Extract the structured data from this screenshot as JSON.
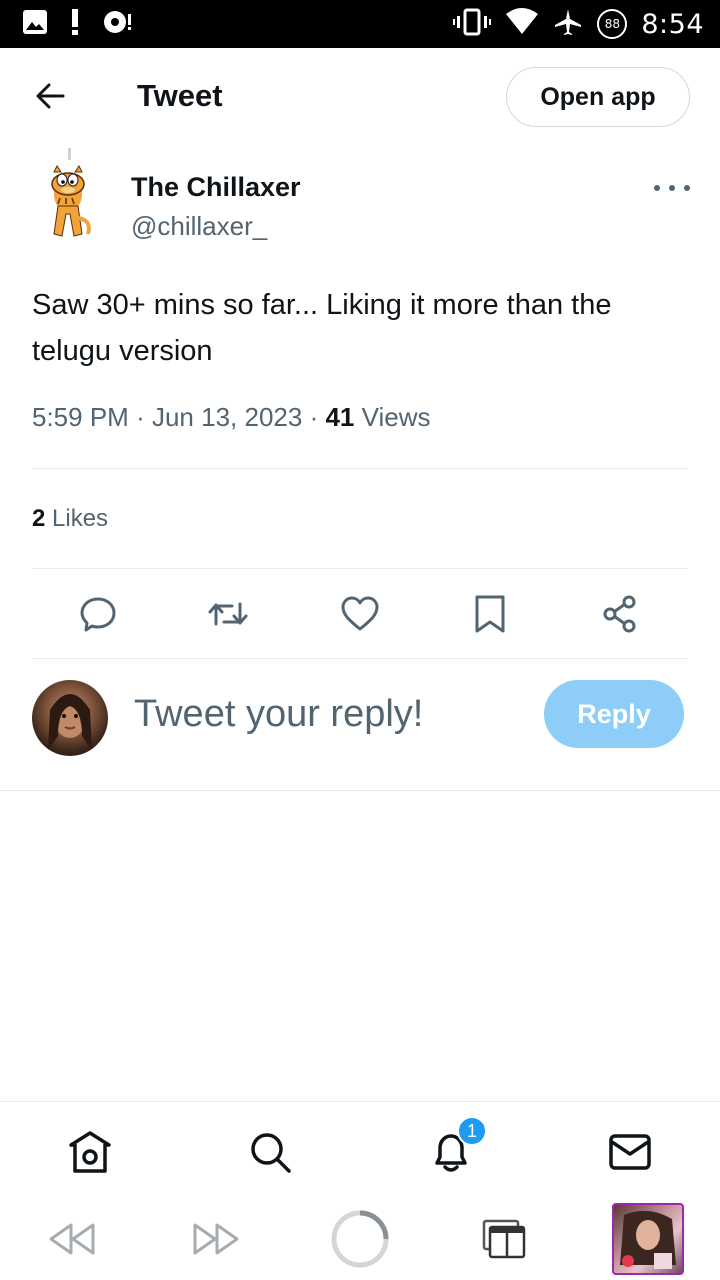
{
  "status_bar": {
    "time": "8:54",
    "battery": "88",
    "left_icons": [
      "image-icon",
      "alert-icon",
      "media-icon"
    ],
    "right_icons": [
      "vibrate-icon",
      "wifi-icon",
      "airplane-icon"
    ]
  },
  "header": {
    "title": "Tweet",
    "open_app": "Open app"
  },
  "tweet": {
    "author_name": "The Chillaxer",
    "author_handle": "@chillaxer_",
    "text": "Saw 30+ mins so far... Liking it more than the telugu version",
    "time": "5:59 PM",
    "date": "Jun 13, 2023",
    "views_count": "41",
    "views_label": "Views",
    "likes_count": "2",
    "likes_label": "Likes",
    "meta_sep": "·"
  },
  "reply": {
    "placeholder": "Tweet your reply!",
    "button": "Reply"
  },
  "bottom_nav": {
    "notifications_badge": "1"
  },
  "colors": {
    "text_primary": "#0f1419",
    "text_secondary": "#536471",
    "accent": "#1d9bf0",
    "reply_disabled": "#8ecdf8",
    "divider": "#e6ecf0"
  }
}
